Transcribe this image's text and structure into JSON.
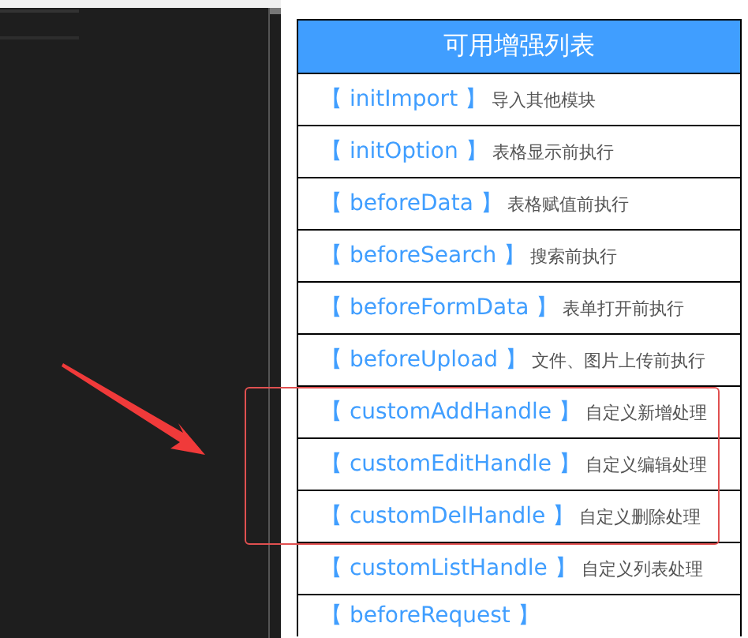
{
  "panel": {
    "title": "可用增强列表"
  },
  "items": [
    {
      "name": "【 initImport 】",
      "desc": "导入其他模块"
    },
    {
      "name": "【 initOption 】",
      "desc": "表格显示前执行"
    },
    {
      "name": "【 beforeData 】",
      "desc": "表格赋值前执行"
    },
    {
      "name": "【 beforeSearch 】",
      "desc": "搜索前执行"
    },
    {
      "name": "【 beforeFormData 】",
      "desc": "表单打开前执行"
    },
    {
      "name": "【 beforeUpload 】",
      "desc": "文件、图片上传前执行"
    },
    {
      "name": "【 customAddHandle 】",
      "desc": "自定义新增处理"
    },
    {
      "name": "【 customEditHandle 】",
      "desc": "自定义编辑处理"
    },
    {
      "name": "【 customDelHandle 】",
      "desc": "自定义删除处理"
    },
    {
      "name": "【 customListHandle 】",
      "desc": "自定义列表处理"
    },
    {
      "name": "【 beforeRequest 】"
    }
  ]
}
